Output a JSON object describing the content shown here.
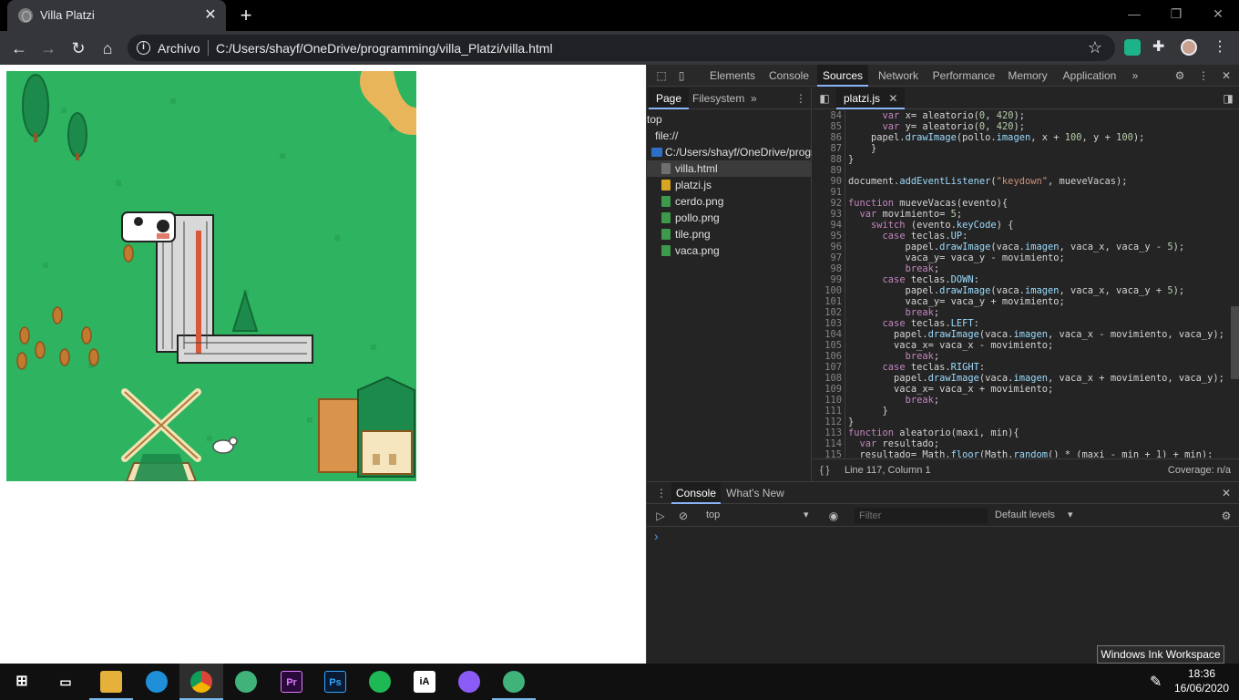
{
  "browser": {
    "tab_title": "Villa Platzi",
    "omnibox_label": "Archivo",
    "url": "C:/Users/shayf/OneDrive/programming/villa_Platzi/villa.html"
  },
  "devtools": {
    "tabs": [
      "Elements",
      "Console",
      "Sources",
      "Network",
      "Performance",
      "Memory",
      "Application"
    ],
    "active_tab": "Sources",
    "navigator_tabs": [
      "Page",
      "Filesystem"
    ],
    "tree": [
      {
        "label": "top",
        "type": "frame"
      },
      {
        "label": "file://",
        "type": "cloud"
      },
      {
        "label": "C:/Users/shayf/OneDrive/program",
        "type": "folder"
      },
      {
        "label": "villa.html",
        "type": "html"
      },
      {
        "label": "platzi.js",
        "type": "js"
      },
      {
        "label": "cerdo.png",
        "type": "img"
      },
      {
        "label": "pollo.png",
        "type": "img"
      },
      {
        "label": "tile.png",
        "type": "img"
      },
      {
        "label": "vaca.png",
        "type": "img"
      }
    ],
    "open_file": "platzi.js",
    "code_lines": [
      {
        "n": "84",
        "t": "      var x= aleatorio(0, 420);"
      },
      {
        "n": "85",
        "t": "      var y= aleatorio(0, 420);"
      },
      {
        "n": "86",
        "t": "    papel.drawImage(pollo.imagen, x + 100, y + 100);"
      },
      {
        "n": "87",
        "t": "    }"
      },
      {
        "n": "88",
        "t": "}"
      },
      {
        "n": "89",
        "t": ""
      },
      {
        "n": "90",
        "t": "document.addEventListener(\"keydown\", mueveVacas);"
      },
      {
        "n": "91",
        "t": ""
      },
      {
        "n": "92",
        "t": "function mueveVacas(evento){"
      },
      {
        "n": "93",
        "t": "  var movimiento= 5;"
      },
      {
        "n": "94",
        "t": "    switch (evento.keyCode) {"
      },
      {
        "n": "95",
        "t": "      case teclas.UP:"
      },
      {
        "n": "96",
        "t": "          papel.drawImage(vaca.imagen, vaca_x, vaca_y - 5);"
      },
      {
        "n": "97",
        "t": "          vaca_y= vaca_y - movimiento;"
      },
      {
        "n": "98",
        "t": "          break;"
      },
      {
        "n": "99",
        "t": "      case teclas.DOWN:"
      },
      {
        "n": "100",
        "t": "          papel.drawImage(vaca.imagen, vaca_x, vaca_y + 5);"
      },
      {
        "n": "101",
        "t": "          vaca_y= vaca_y + movimiento;"
      },
      {
        "n": "102",
        "t": "          break;"
      },
      {
        "n": "103",
        "t": "      case teclas.LEFT:"
      },
      {
        "n": "104",
        "t": "        papel.drawImage(vaca.imagen, vaca_x - movimiento, vaca_y);"
      },
      {
        "n": "105",
        "t": "        vaca_x= vaca_x - movimiento;"
      },
      {
        "n": "106",
        "t": "          break;"
      },
      {
        "n": "107",
        "t": "      case teclas.RIGHT:"
      },
      {
        "n": "108",
        "t": "        papel.drawImage(vaca.imagen, vaca_x + movimiento, vaca_y);"
      },
      {
        "n": "109",
        "t": "        vaca_x= vaca_x + movimiento;"
      },
      {
        "n": "110",
        "t": "          break;"
      },
      {
        "n": "111",
        "t": "      }"
      },
      {
        "n": "112",
        "t": "}"
      },
      {
        "n": "113",
        "t": "function aleatorio(maxi, min){"
      },
      {
        "n": "114",
        "t": "  var resultado;"
      },
      {
        "n": "115",
        "t": "  resultado= Math.floor(Math.random() * (maxi - min + 1) + min);"
      }
    ],
    "status_position": "Line 117, Column 1",
    "status_coverage": "Coverage: n/a",
    "drawer_tabs": [
      "Console",
      "What's New"
    ],
    "context": "top",
    "filter_placeholder": "Filter",
    "levels": "Default levels",
    "prompt": "›"
  },
  "taskbar": {
    "apps": [
      "start",
      "task-view",
      "file-explorer",
      "edge",
      "chrome",
      "atom",
      "premiere-pro",
      "photoshop",
      "spotify",
      "ia-writer",
      "app-circle",
      "atom-2"
    ],
    "tooltip": "Windows Ink Workspace",
    "time": "18:36",
    "date": "16/06/2020"
  },
  "colors": {
    "grass": "#2eb360",
    "devtools_bg": "#242424",
    "accent": "#8ab4f8",
    "keyword": "#c586c0",
    "string": "#ce9178",
    "number": "#b5cea8",
    "prop": "#9cdcfe"
  }
}
